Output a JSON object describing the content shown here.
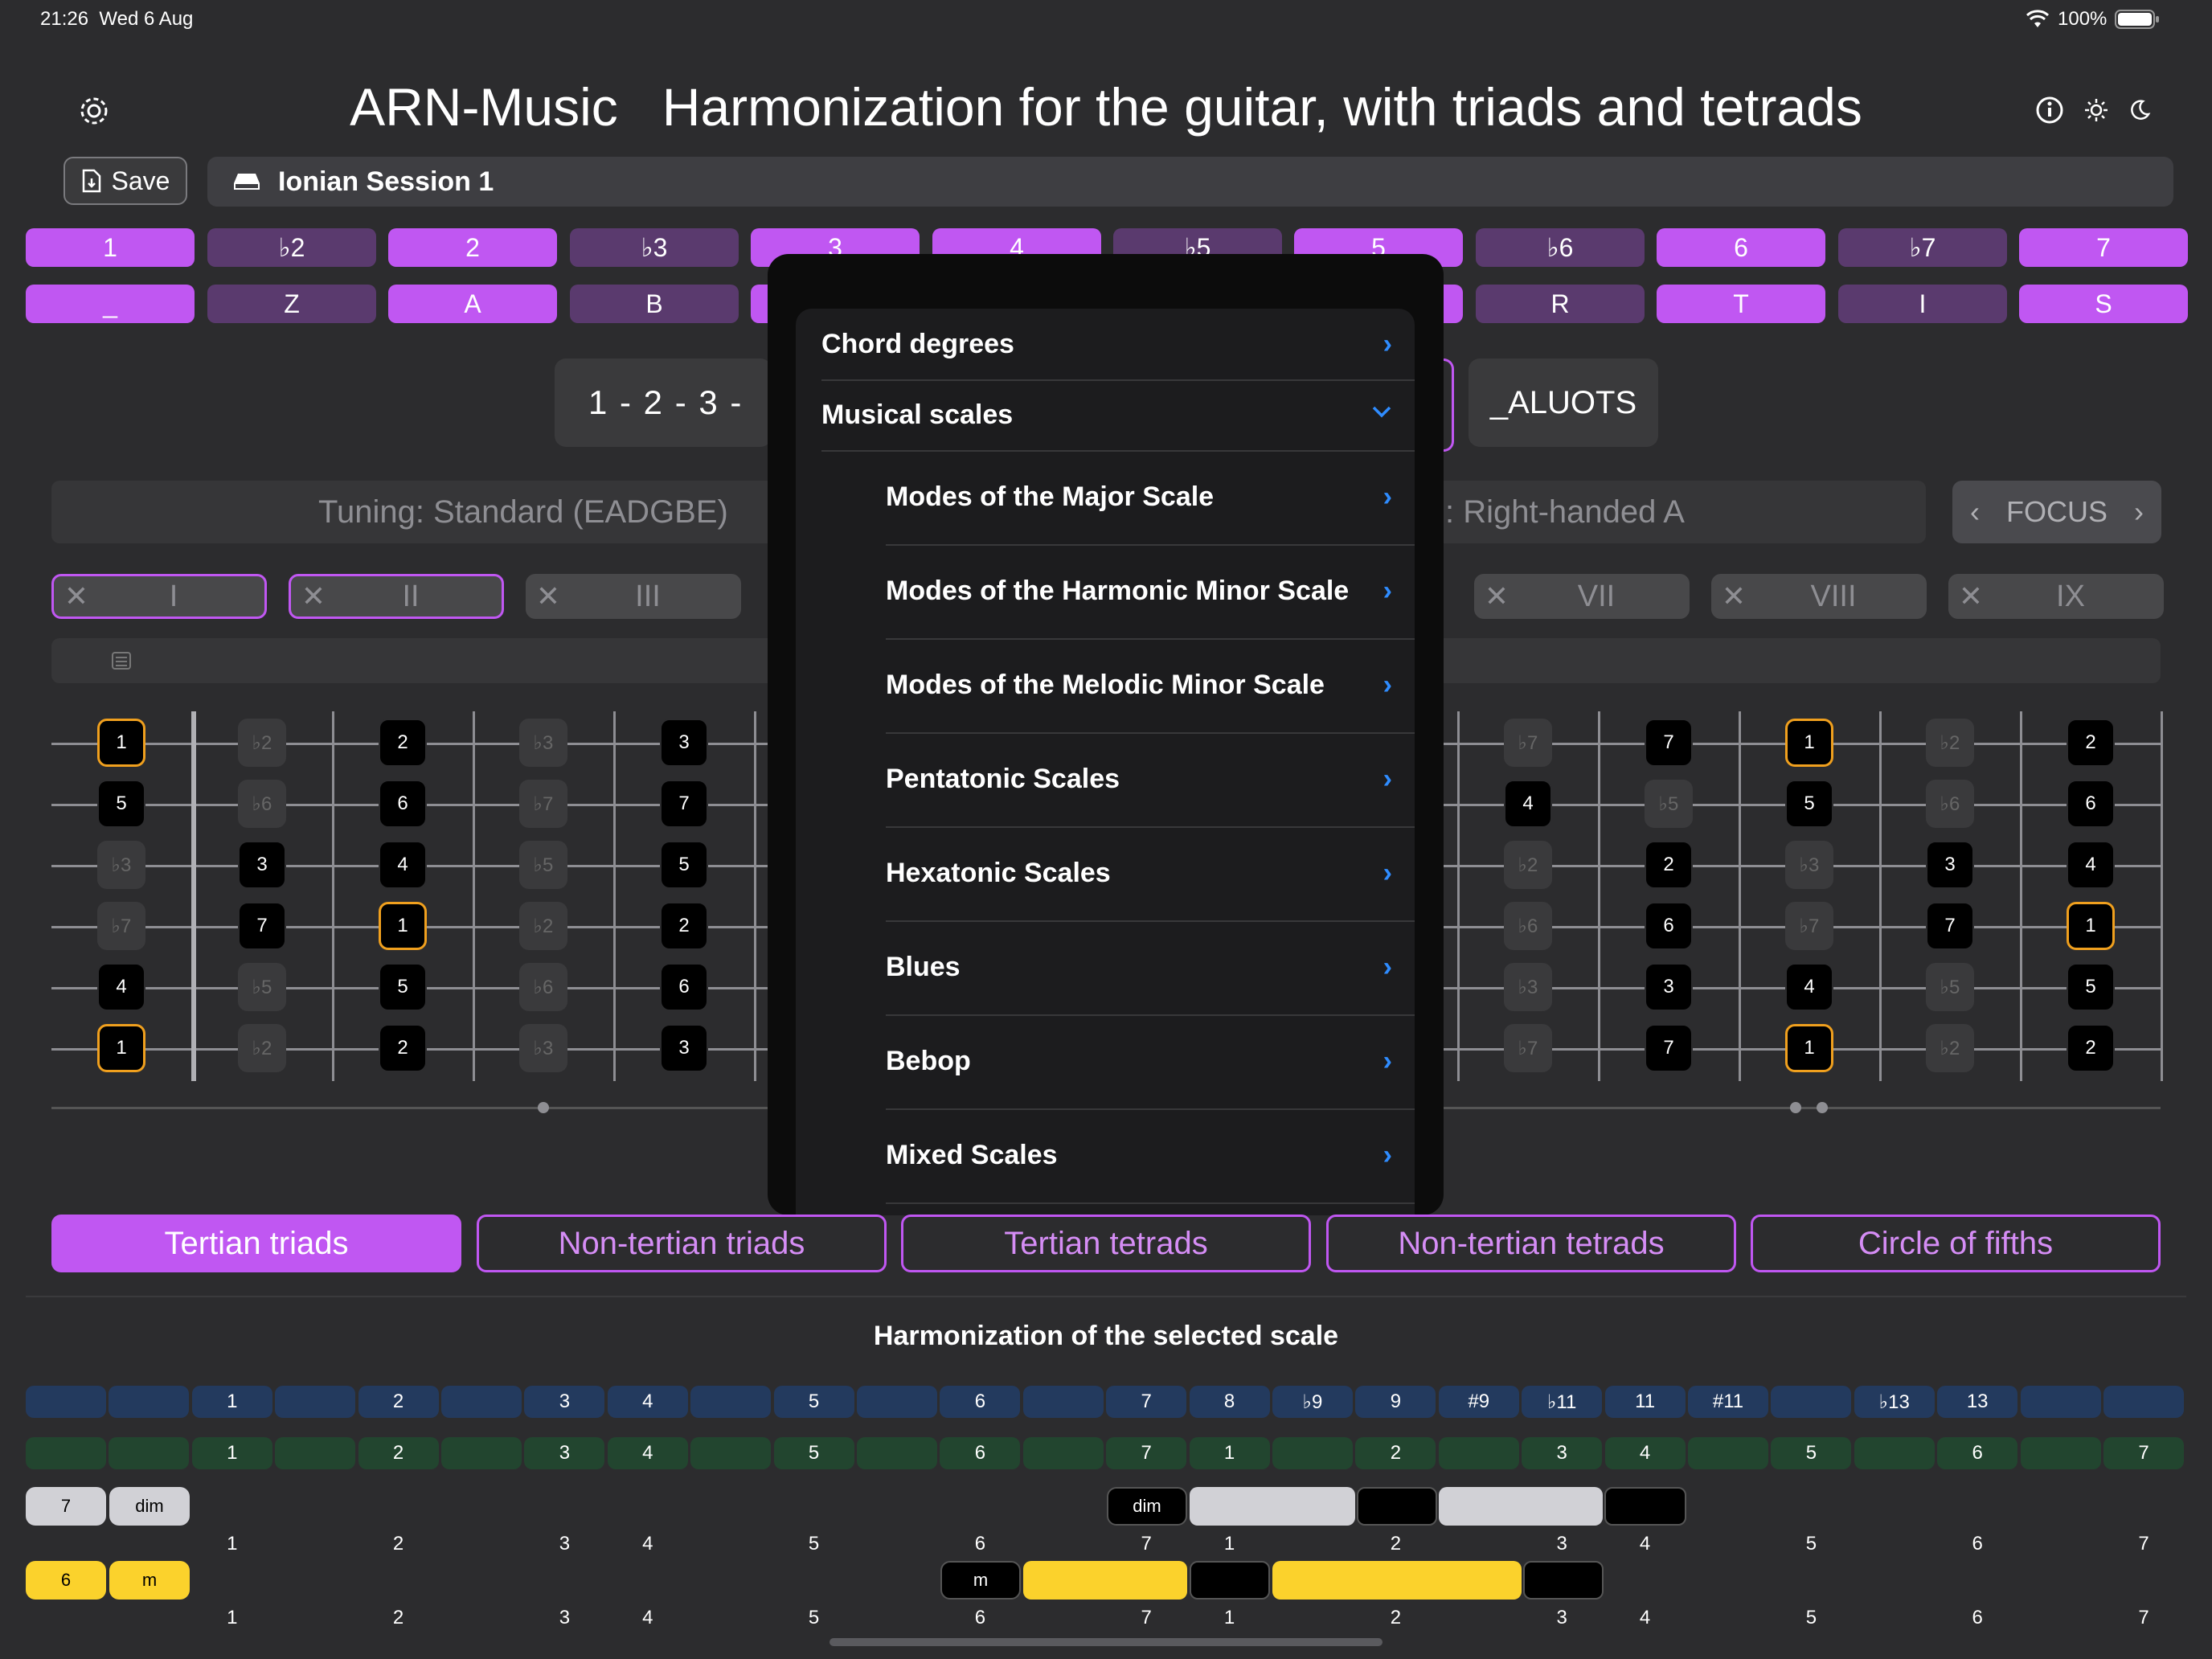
{
  "status": {
    "time": "21:26",
    "date": "Wed 6 Aug",
    "battery": "100%"
  },
  "header": {
    "title": "ARN-Music   Harmonization for the guitar, with triads and tetrads"
  },
  "toolbar": {
    "save_label": "Save",
    "session_name": "Ionian Session 1"
  },
  "degrees": [
    {
      "label": "1",
      "on": true
    },
    {
      "label": "♭2",
      "on": false
    },
    {
      "label": "2",
      "on": true
    },
    {
      "label": "♭3",
      "on": false
    },
    {
      "label": "3",
      "on": true
    },
    {
      "label": "4",
      "on": true
    },
    {
      "label": "♭5",
      "on": false
    },
    {
      "label": "5",
      "on": true
    },
    {
      "label": "♭6",
      "on": false
    },
    {
      "label": "6",
      "on": true
    },
    {
      "label": "♭7",
      "on": false
    },
    {
      "label": "7",
      "on": true
    }
  ],
  "letters": [
    {
      "label": "_",
      "on": true
    },
    {
      "label": "Z",
      "on": false
    },
    {
      "label": "A",
      "on": true
    },
    {
      "label": "B",
      "on": false
    },
    {
      "label": "",
      "on": true
    },
    {
      "label": "",
      "on": true
    },
    {
      "label": "",
      "on": false
    },
    {
      "label": "",
      "on": true
    },
    {
      "label": "R",
      "on": false
    },
    {
      "label": "T",
      "on": true
    },
    {
      "label": "I",
      "on": false
    },
    {
      "label": "S",
      "on": true
    }
  ],
  "sequence": {
    "text": "1 - 2 - 3 -",
    "letters": "_ALUOTS"
  },
  "tuning": {
    "label": "Tuning: Standard (EADGBE)",
    "hand": ": Right-handed A",
    "focus": "FOCUS"
  },
  "positions": [
    {
      "label": "I",
      "selected": true
    },
    {
      "label": "II",
      "selected": true
    },
    {
      "label": "III",
      "selected": false
    },
    {
      "label": "VII",
      "selected": false
    },
    {
      "label": "VIII",
      "selected": false
    },
    {
      "label": "IX",
      "selected": false
    }
  ],
  "fretboard": {
    "columns_left": [
      [
        "1",
        "5",
        "♭3",
        "♭7",
        "4",
        "1"
      ],
      [
        "♭2",
        "♭6",
        "3",
        "7",
        "♭5",
        "♭2"
      ],
      [
        "2",
        "6",
        "4",
        "1",
        "5",
        "2"
      ],
      [
        "♭3",
        "♭7",
        "♭5",
        "♭2",
        "♭6",
        "♭3"
      ],
      [
        "3",
        "7",
        "5",
        "2",
        "6",
        "3"
      ]
    ],
    "columns_right": [
      [
        "♭7",
        "4",
        "♭2",
        "♭6",
        "♭3",
        "♭7"
      ],
      [
        "7",
        "♭5",
        "2",
        "6",
        "3",
        "7"
      ],
      [
        "1",
        "5",
        "♭3",
        "♭7",
        "4",
        "1"
      ],
      [
        "♭2",
        "♭6",
        "3",
        "7",
        "♭5",
        "♭2"
      ],
      [
        "2",
        "6",
        "4",
        "1",
        "5",
        "2"
      ]
    ]
  },
  "menu": {
    "items": [
      {
        "label": "Chord degrees",
        "type": "right"
      },
      {
        "label": "Musical scales",
        "type": "down"
      }
    ],
    "subitems": [
      "Modes of the Major Scale",
      "Modes of the Harmonic Minor Scale",
      "Modes of the Melodic Minor Scale",
      "Pentatonic Scales",
      "Hexatonic Scales",
      "Blues",
      "Bebop",
      "Mixed Scales"
    ]
  },
  "tabs": [
    {
      "label": "Tertian triads",
      "active": true
    },
    {
      "label": "Non-tertian triads",
      "active": false
    },
    {
      "label": "Tertian tetrads",
      "active": false
    },
    {
      "label": "Non-tertian tetrads",
      "active": false
    },
    {
      "label": "Circle of fifths",
      "active": false
    }
  ],
  "harmonization": {
    "title": "Harmonization of the selected scale",
    "intervals": [
      "",
      "",
      "1",
      "",
      "2",
      "",
      "3",
      "4",
      "",
      "5",
      "",
      "6",
      "",
      "7",
      "8",
      "♭9",
      "9",
      "#9",
      "♭11",
      "11",
      "#11",
      "",
      "♭13",
      "13",
      "",
      ""
    ],
    "degrees": [
      "",
      "",
      "1",
      "",
      "2",
      "",
      "3",
      "4",
      "",
      "5",
      "",
      "6",
      "",
      "7",
      "1",
      "",
      "2",
      "",
      "3",
      "4",
      "",
      "5",
      "",
      "6",
      "",
      "7"
    ],
    "rows": [
      {
        "tag1": "7",
        "tag2": "dim",
        "quality": "dim",
        "numbers": [
          "1",
          "2",
          "3",
          "4",
          "5",
          "6",
          "7",
          "1",
          "2",
          "3",
          "4",
          "5",
          "6",
          "7"
        ]
      },
      {
        "tag1": "6",
        "tag2": "m",
        "quality": "m",
        "numbers": [
          "1",
          "2",
          "3",
          "4",
          "5",
          "6",
          "7",
          "1",
          "2",
          "3",
          "4",
          "5",
          "6",
          "7"
        ]
      }
    ]
  },
  "colors": {
    "accent": "#c057f2",
    "root_outline": "#f0a01e",
    "blue_row": "#233a5e",
    "green_row": "#22452f",
    "yellow": "#fbd22c"
  }
}
